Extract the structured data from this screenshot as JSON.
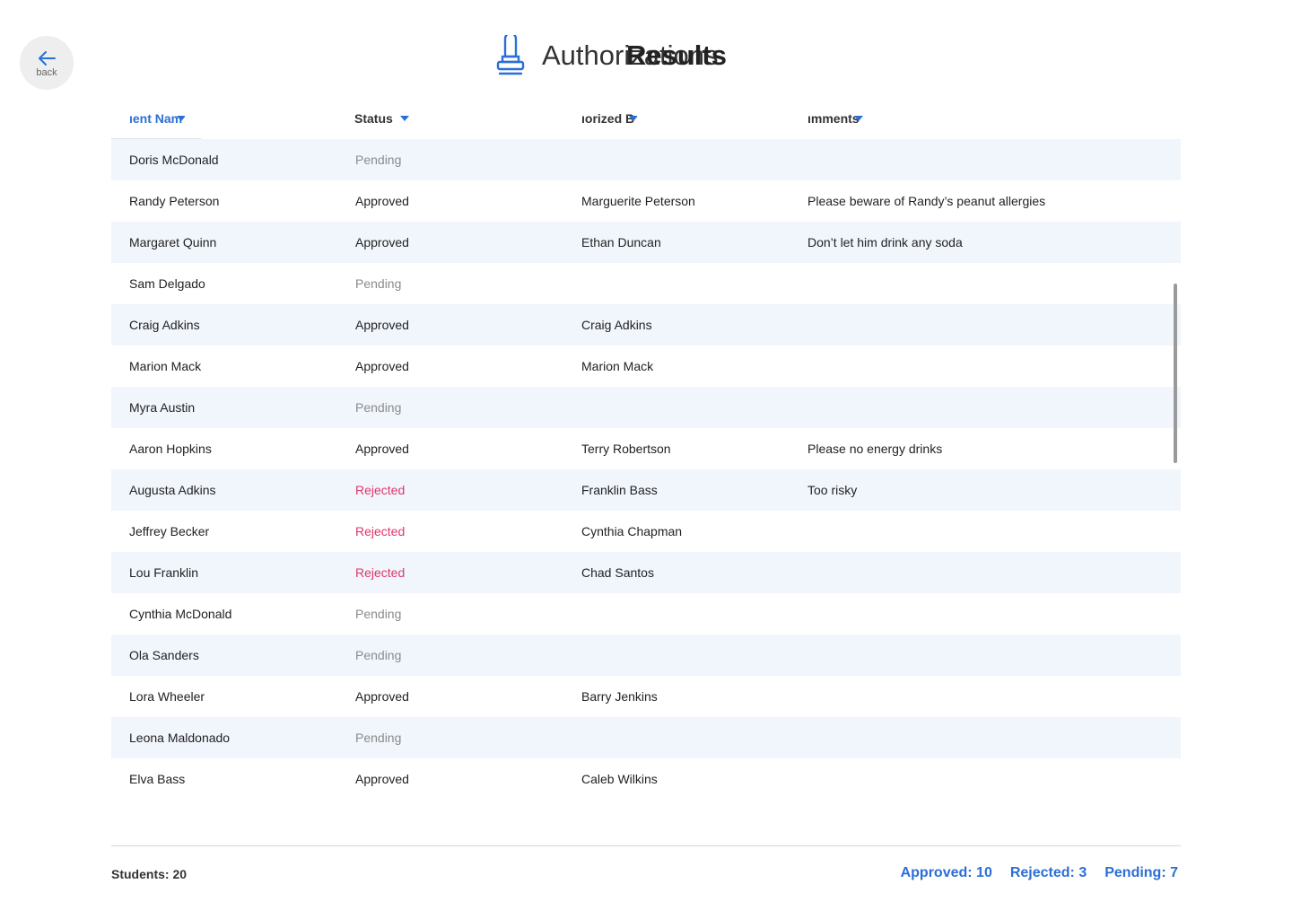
{
  "back": {
    "label": "back"
  },
  "header": {
    "title_old": "Authorizations",
    "title_new": "Results"
  },
  "table": {
    "columns": [
      "ıent Nam",
      "Status",
      "ıorized B",
      "ımments"
    ],
    "rows": [
      {
        "name": "Doris McDonald",
        "status": "Pending",
        "authorized_by": "",
        "comments": ""
      },
      {
        "name": "Randy Peterson",
        "status": "Approved",
        "authorized_by": "Marguerite Peterson",
        "comments": "Please beware of Randy’s peanut allergies"
      },
      {
        "name": "Margaret Quinn",
        "status": "Approved",
        "authorized_by": "Ethan Duncan",
        "comments": "Don’t let him drink any soda"
      },
      {
        "name": "Sam Delgado",
        "status": "Pending",
        "authorized_by": "",
        "comments": ""
      },
      {
        "name": "Craig Adkins",
        "status": "Approved",
        "authorized_by": "Craig Adkins",
        "comments": ""
      },
      {
        "name": "Marion Mack",
        "status": "Approved",
        "authorized_by": "Marion Mack",
        "comments": ""
      },
      {
        "name": "Myra Austin",
        "status": "Pending",
        "authorized_by": "",
        "comments": ""
      },
      {
        "name": "Aaron Hopkins",
        "status": "Approved",
        "authorized_by": "Terry Robertson",
        "comments": "Please no energy drinks"
      },
      {
        "name": "Augusta Adkins",
        "status": "Rejected",
        "authorized_by": "Franklin Bass",
        "comments": "Too risky"
      },
      {
        "name": "Jeffrey Becker",
        "status": "Rejected",
        "authorized_by": "Cynthia Chapman",
        "comments": ""
      },
      {
        "name": "Lou Franklin",
        "status": "Rejected",
        "authorized_by": "Chad Santos",
        "comments": ""
      },
      {
        "name": "Cynthia McDonald",
        "status": "Pending",
        "authorized_by": "",
        "comments": ""
      },
      {
        "name": "Ola Sanders",
        "status": "Pending",
        "authorized_by": "",
        "comments": ""
      },
      {
        "name": "Lora Wheeler",
        "status": "Approved",
        "authorized_by": "Barry Jenkins",
        "comments": ""
      },
      {
        "name": "Leona Maldonado",
        "status": "Pending",
        "authorized_by": "",
        "comments": ""
      },
      {
        "name": "Elva Bass",
        "status": "Approved",
        "authorized_by": "Caleb Wilkins",
        "comments": ""
      }
    ]
  },
  "footer": {
    "students": "Students: 20",
    "approved": "Approved: 10",
    "rejected": "Rejected: 3",
    "pending": "Pending: 7"
  },
  "colors": {
    "accent": "#2b6fd6",
    "rejected": "#e0366a",
    "row_alt": "#f1f6fd"
  },
  "icons": {
    "back": "arrow-left-icon",
    "title": "stamp-icon",
    "sort": "caret-down-icon"
  }
}
